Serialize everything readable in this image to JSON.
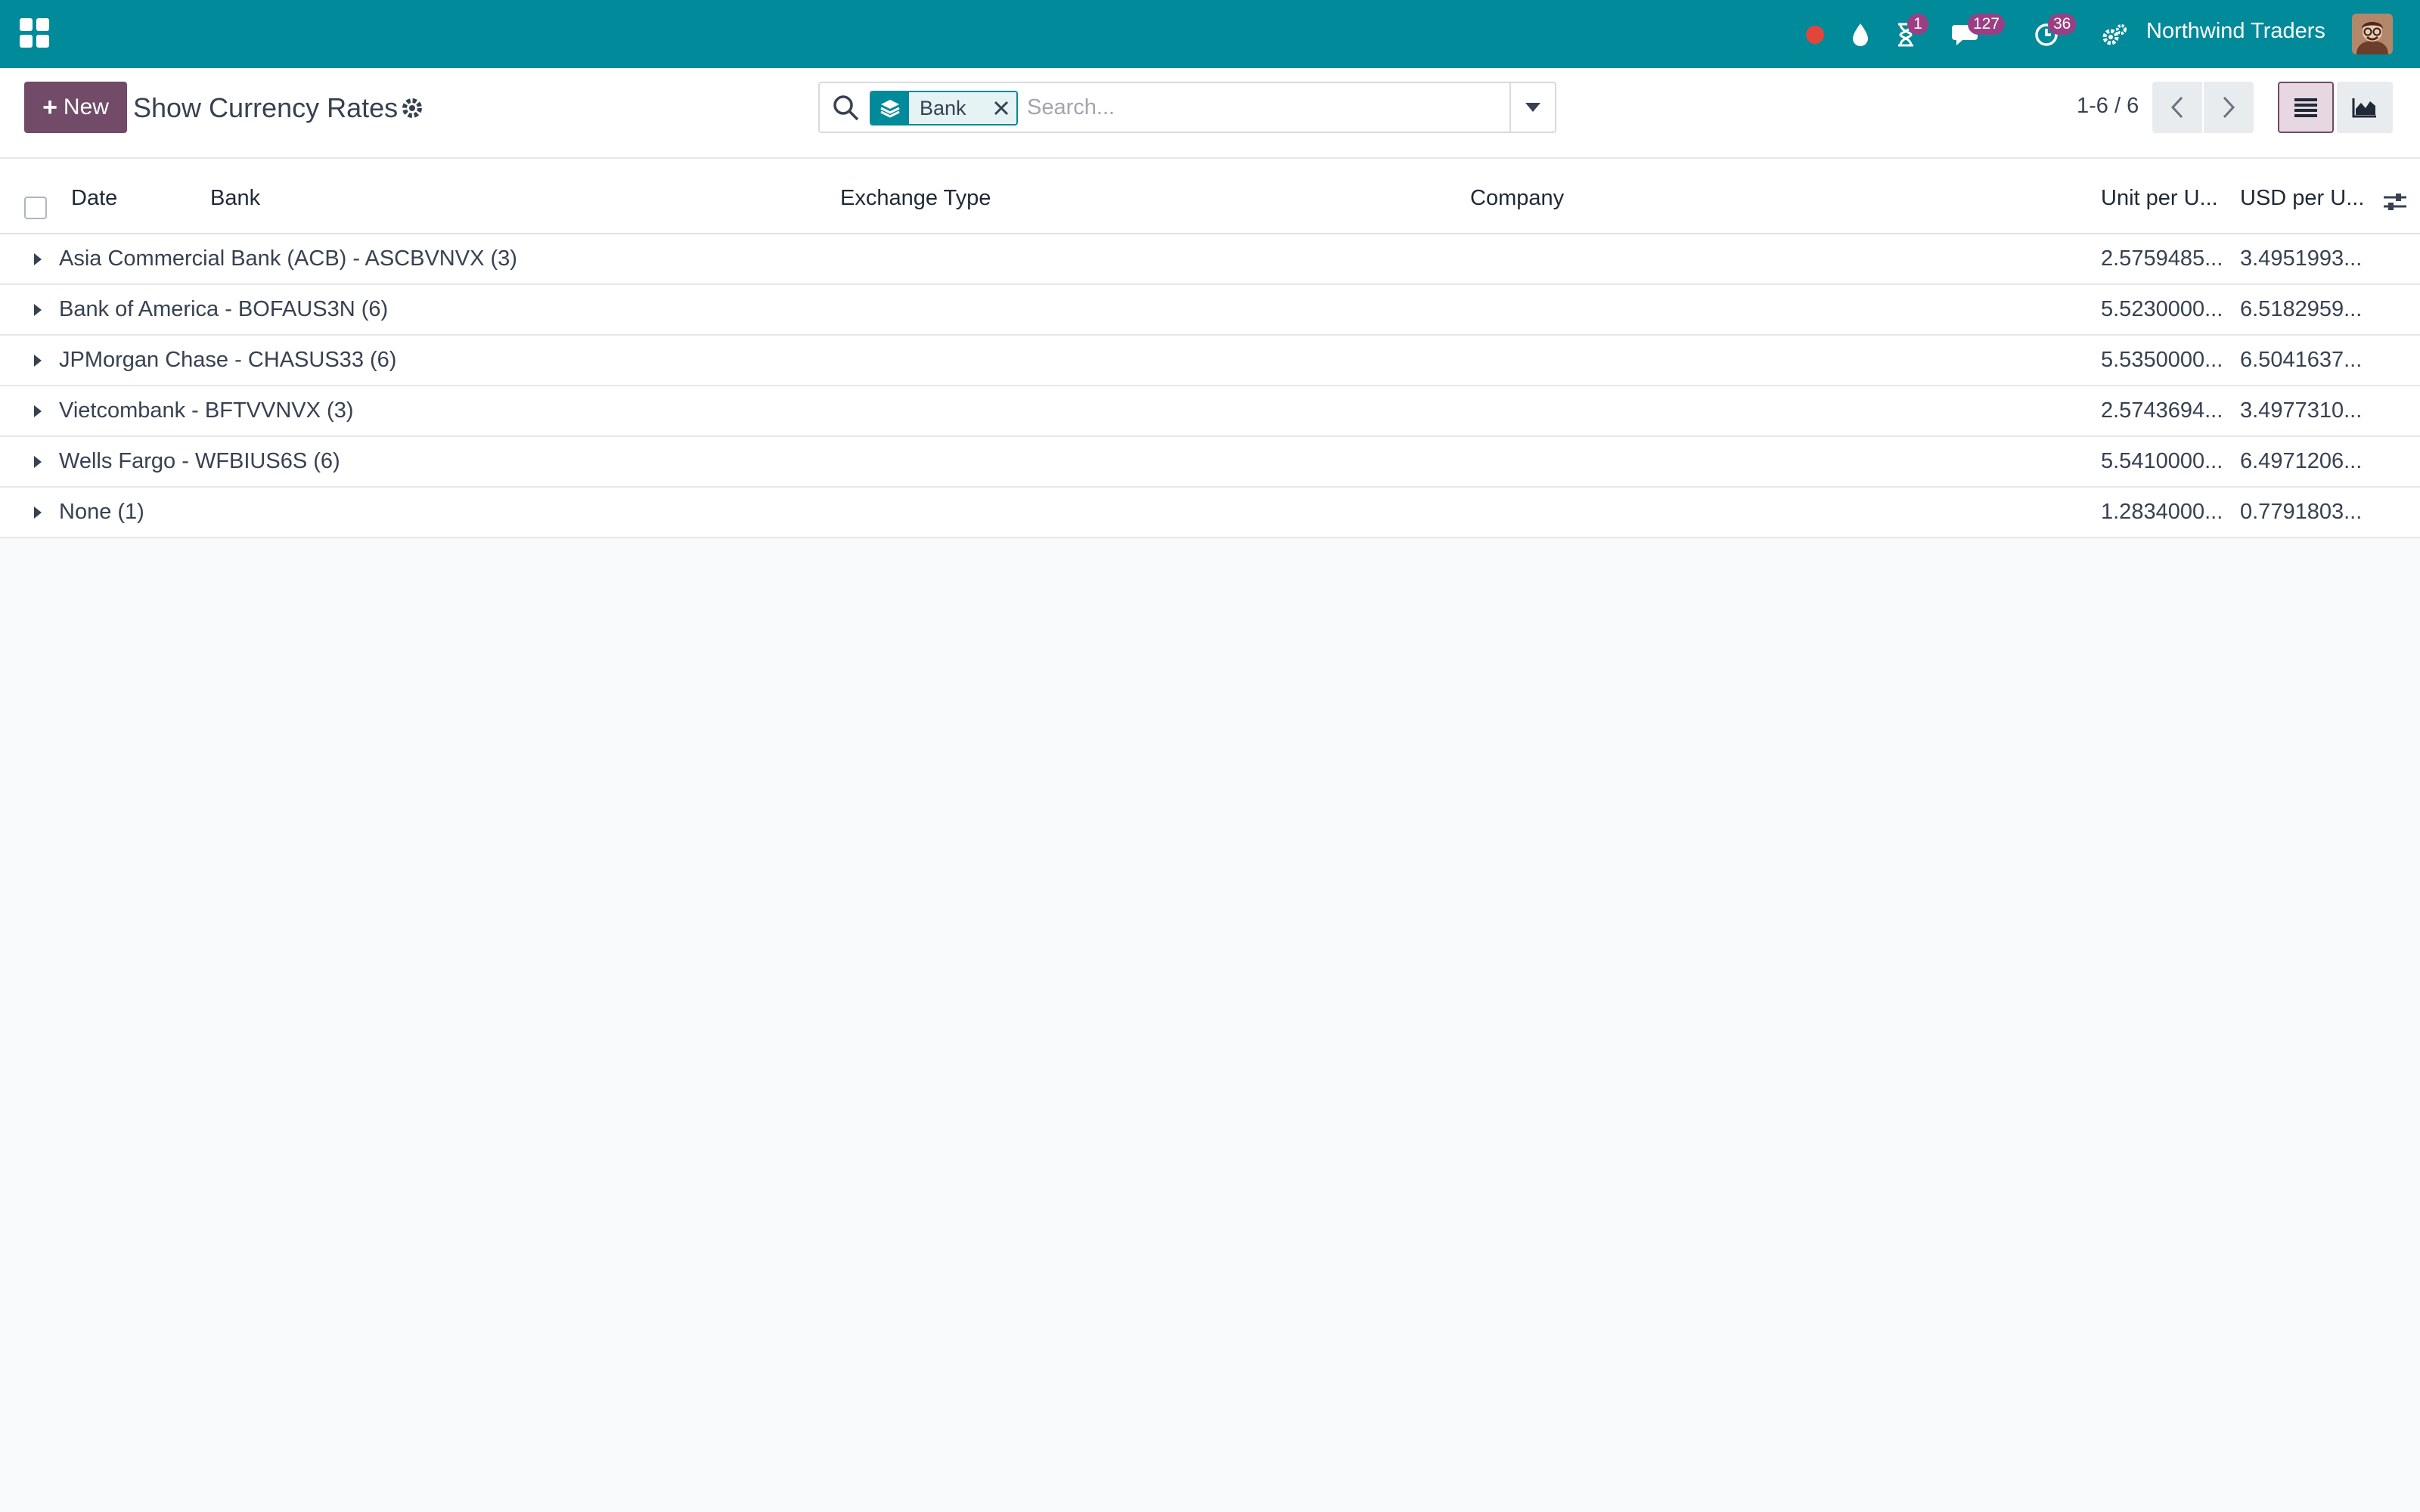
{
  "navbar": {
    "company": "Northwind Traders",
    "activity_badge": "1",
    "messages_badge": "127",
    "timers_badge": "36"
  },
  "control_panel": {
    "new_label": "New",
    "title": "Show Currency Rates",
    "search": {
      "facet_label": "Bank",
      "placeholder": "Search..."
    },
    "pager": "1-6 / 6"
  },
  "table": {
    "columns": {
      "date": "Date",
      "bank": "Bank",
      "exchange_type": "Exchange Type",
      "company": "Company",
      "unit_per_usd": "Unit per U...",
      "usd_per_unit": "USD per U..."
    },
    "groups": [
      {
        "name": "Asia Commercial Bank (ACB) - ASCBVNVX (3)",
        "unit_per": "2.5759485...",
        "usd_per": "3.4951993..."
      },
      {
        "name": "Bank of America - BOFAUS3N (6)",
        "unit_per": "5.5230000...",
        "usd_per": "6.5182959..."
      },
      {
        "name": "JPMorgan Chase - CHASUS33 (6)",
        "unit_per": "5.5350000...",
        "usd_per": "6.5041637..."
      },
      {
        "name": "Vietcombank - BFTVVNVX (3)",
        "unit_per": "2.5743694...",
        "usd_per": "3.4977310..."
      },
      {
        "name": "Wells Fargo - WFBIUS6S (6)",
        "unit_per": "5.5410000...",
        "usd_per": "6.4971206..."
      },
      {
        "name": "None (1)",
        "unit_per": "1.2834000...",
        "usd_per": "0.7791803..."
      }
    ]
  },
  "colors": {
    "navbar": "#018a9a",
    "primary_button": "#714b67",
    "badge": "#9b3f85",
    "background": "#f9fafb"
  },
  "icons": [
    "apps-icon",
    "record-icon",
    "drop-icon",
    "hourglass-icon",
    "chat-icon",
    "clock-icon",
    "settings-icon",
    "gear-icon",
    "search-icon",
    "layers-icon",
    "close-icon",
    "caret-down-icon",
    "chevron-left-icon",
    "chevron-right-icon",
    "list-view-icon",
    "graph-view-icon",
    "sliders-icon",
    "caret-right-icon"
  ]
}
